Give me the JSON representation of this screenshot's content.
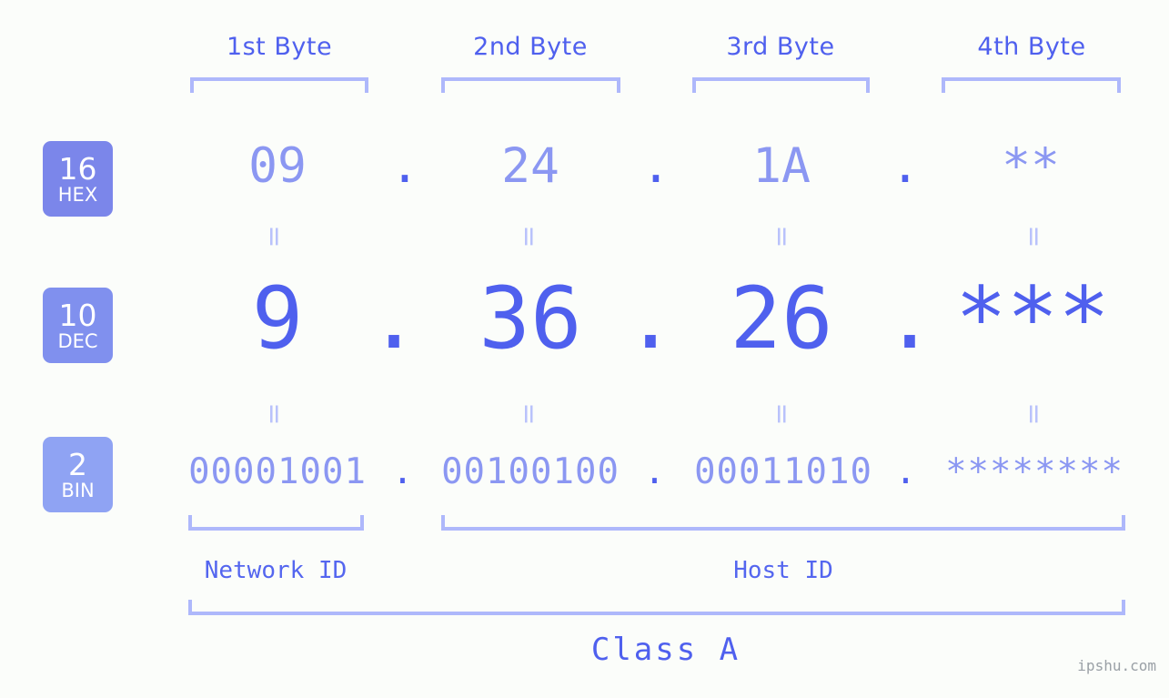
{
  "meta": {
    "background": "#fbfdfa",
    "accent_dark": "#4f60ee",
    "accent_mid": "#8b97f2",
    "accent_light": "#aeb8fb",
    "watermark": "ipshu.com"
  },
  "header": {
    "byte_labels": [
      "1st Byte",
      "2nd Byte",
      "3rd Byte",
      "4th Byte"
    ]
  },
  "bases": [
    {
      "num": "16",
      "name": "HEX",
      "color": "#7b86ea"
    },
    {
      "num": "10",
      "name": "DEC",
      "color": "#8090ee"
    },
    {
      "num": "2",
      "name": "BIN",
      "color": "#8fa3f3"
    }
  ],
  "rows": {
    "hex": {
      "values": [
        "09",
        "24",
        "1A",
        "**"
      ],
      "separator": "."
    },
    "dec": {
      "values": [
        "9",
        "36",
        "26",
        "***"
      ],
      "separator": "."
    },
    "bin": {
      "values": [
        "00001001",
        "00100100",
        "00011010",
        "********"
      ],
      "separator": "."
    }
  },
  "equivalence_marker": "=",
  "sections": {
    "network_id": "Network ID",
    "host_id": "Host ID",
    "class": "Class A"
  }
}
